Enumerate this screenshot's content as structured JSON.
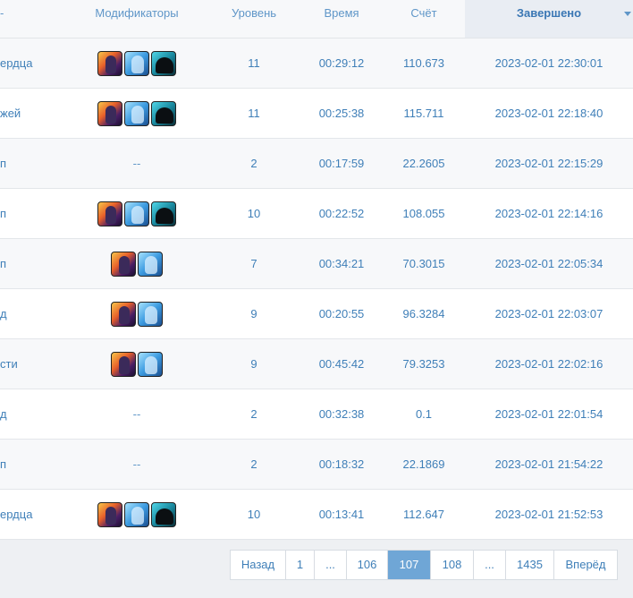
{
  "header": {
    "mods_label": "Модификаторы",
    "level_label": "Уровень",
    "time_label": "Время",
    "score_label": "Счёт",
    "done_label": "Завершено"
  },
  "rows": [
    {
      "name": "ердца",
      "mods": [
        "fire",
        "ice",
        "dark"
      ],
      "level": "11",
      "time": "00:29:12",
      "score": "110.673",
      "done": "2023-02-01 22:30:01"
    },
    {
      "name": "жей",
      "mods": [
        "fire",
        "ice",
        "dark"
      ],
      "level": "11",
      "time": "00:25:38",
      "score": "115.711",
      "done": "2023-02-01 22:18:40"
    },
    {
      "name": "п",
      "mods": [],
      "level": "2",
      "time": "00:17:59",
      "score": "22.2605",
      "done": "2023-02-01 22:15:29"
    },
    {
      "name": "п",
      "mods": [
        "fire",
        "ice",
        "dark"
      ],
      "level": "10",
      "time": "00:22:52",
      "score": "108.055",
      "done": "2023-02-01 22:14:16"
    },
    {
      "name": "п",
      "mods": [
        "fire",
        "ice"
      ],
      "level": "7",
      "time": "00:34:21",
      "score": "70.3015",
      "done": "2023-02-01 22:05:34"
    },
    {
      "name": "д",
      "mods": [
        "fire",
        "ice"
      ],
      "level": "9",
      "time": "00:20:55",
      "score": "96.3284",
      "done": "2023-02-01 22:03:07"
    },
    {
      "name": "сти",
      "mods": [
        "fire",
        "ice"
      ],
      "level": "9",
      "time": "00:45:42",
      "score": "79.3253",
      "done": "2023-02-01 22:02:16"
    },
    {
      "name": "д",
      "mods": [],
      "level": "2",
      "time": "00:32:38",
      "score": "0.1",
      "done": "2023-02-01 22:01:54"
    },
    {
      "name": "п",
      "mods": [],
      "level": "2",
      "time": "00:18:32",
      "score": "22.1869",
      "done": "2023-02-01 21:54:22"
    },
    {
      "name": "ердца",
      "mods": [
        "fire",
        "ice",
        "dark"
      ],
      "level": "10",
      "time": "00:13:41",
      "score": "112.647",
      "done": "2023-02-01 21:52:53"
    }
  ],
  "empty_mods": "--",
  "pagination": [
    {
      "label": "Назад",
      "active": false
    },
    {
      "label": "1",
      "active": false
    },
    {
      "label": "...",
      "active": false
    },
    {
      "label": "106",
      "active": false
    },
    {
      "label": "107",
      "active": true
    },
    {
      "label": "108",
      "active": false
    },
    {
      "label": "...",
      "active": false
    },
    {
      "label": "1435",
      "active": false
    },
    {
      "label": "Вперёд",
      "active": false
    }
  ],
  "icons": {
    "fire": "fire-modifier-icon",
    "ice": "ice-modifier-icon",
    "dark": "shadow-modifier-icon"
  }
}
